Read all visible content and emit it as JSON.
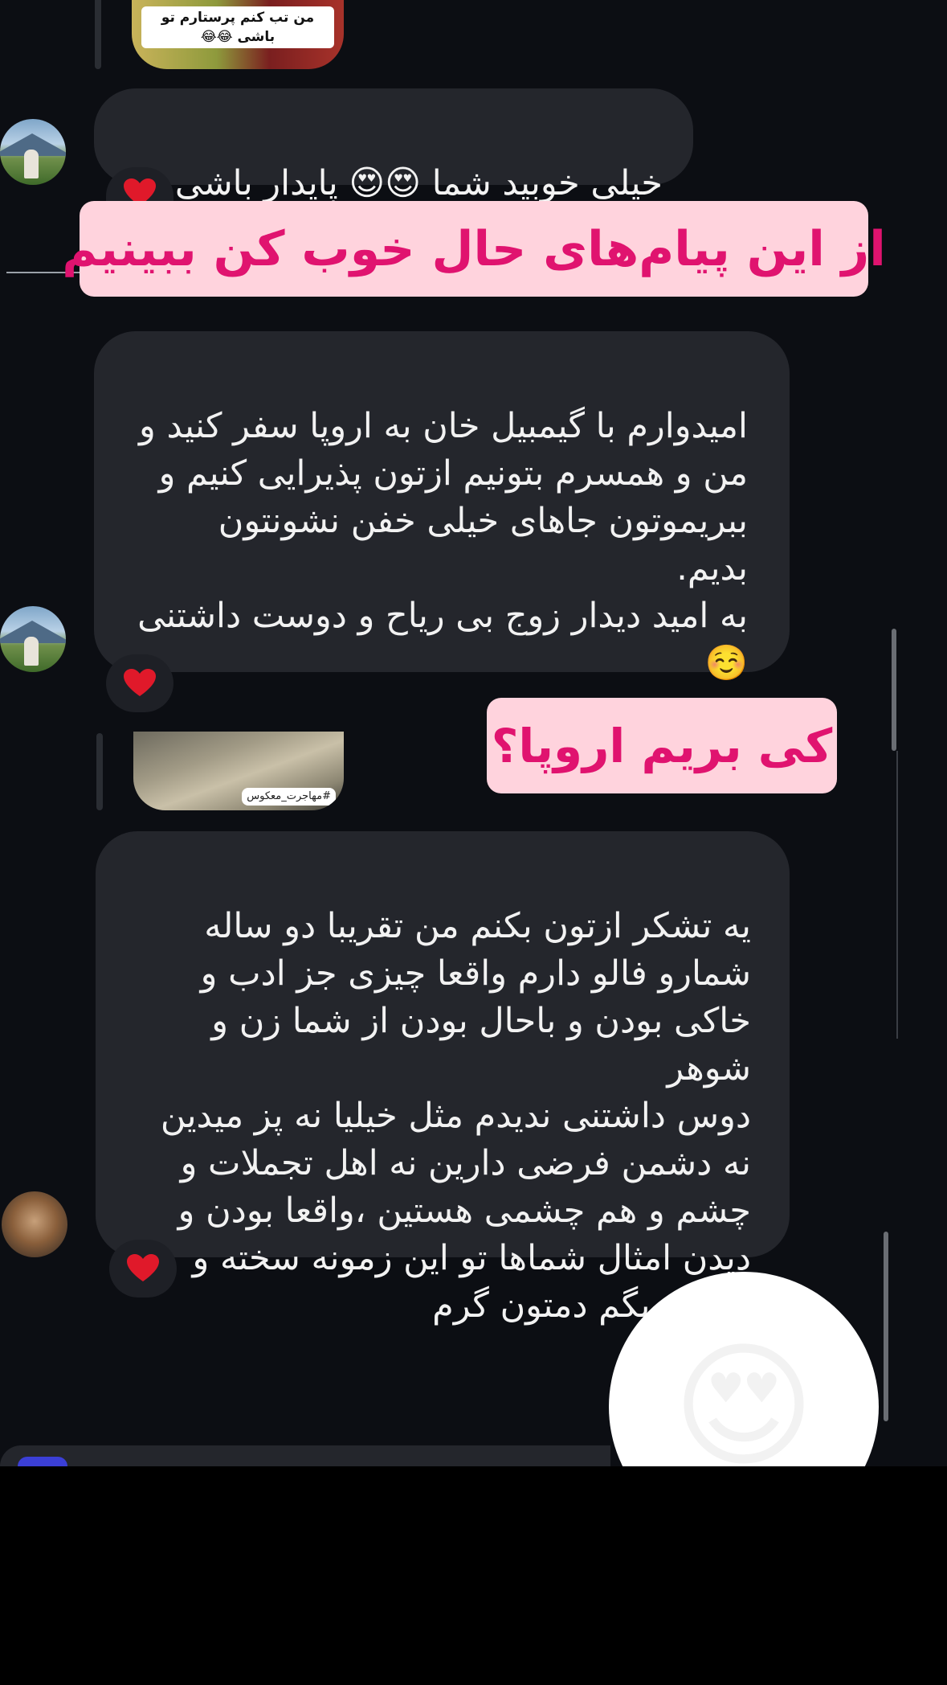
{
  "messages": [
    {
      "text": "خیلی خوبید شما 😍😍 پایدار باشی",
      "reaction": "❤️",
      "reply_thumb_caption": "من تب کنم پرستارم تو باشی 😂😂"
    },
    {
      "text": "امیدوارم با گیمبیل خان به اروپا سفر کنید و\nمن و همسرم بتونیم ازتون پذیرایی کنیم و\nببریموتون جاهای خیلی خفن نشونتون\nبدیم.\nبه امید دیدار زوج بی ریاح و دوست داشتنی\n☺️",
      "reaction": "❤️"
    },
    {
      "text": "یه تشکر ازتون بکنم من تقریبا دو ساله\nشمارو فالو دارم واقعا چیزی جز ادب و\nخاکی بودن و باحال بودن از شما زن و شوهر\nدوس داشتنی ندیدم مثل خیلیا نه پز میدین\nنه دشمن فرضی دارین نه اهل تجملات و\nچشم و هم چشمی هستین ،واقعا بودن و\nدیدن امثال شماها تو این زمونه سخته و\nخلاصه بگم دمتون گرم",
      "reaction": "❤️",
      "reply_thumb_caption": "#مهاجرت_معکوس"
    }
  ],
  "banners": {
    "top": "از این پیام‌های حال خوب کن ببینیم",
    "middle": "کی بریم اروپا؟"
  },
  "sticker": {
    "emoji": "😍"
  },
  "colors": {
    "background": "#0c0e13",
    "bubble": "#24262c",
    "banner_bg": "#ffd3dd",
    "banner_text": "#e0136f"
  }
}
